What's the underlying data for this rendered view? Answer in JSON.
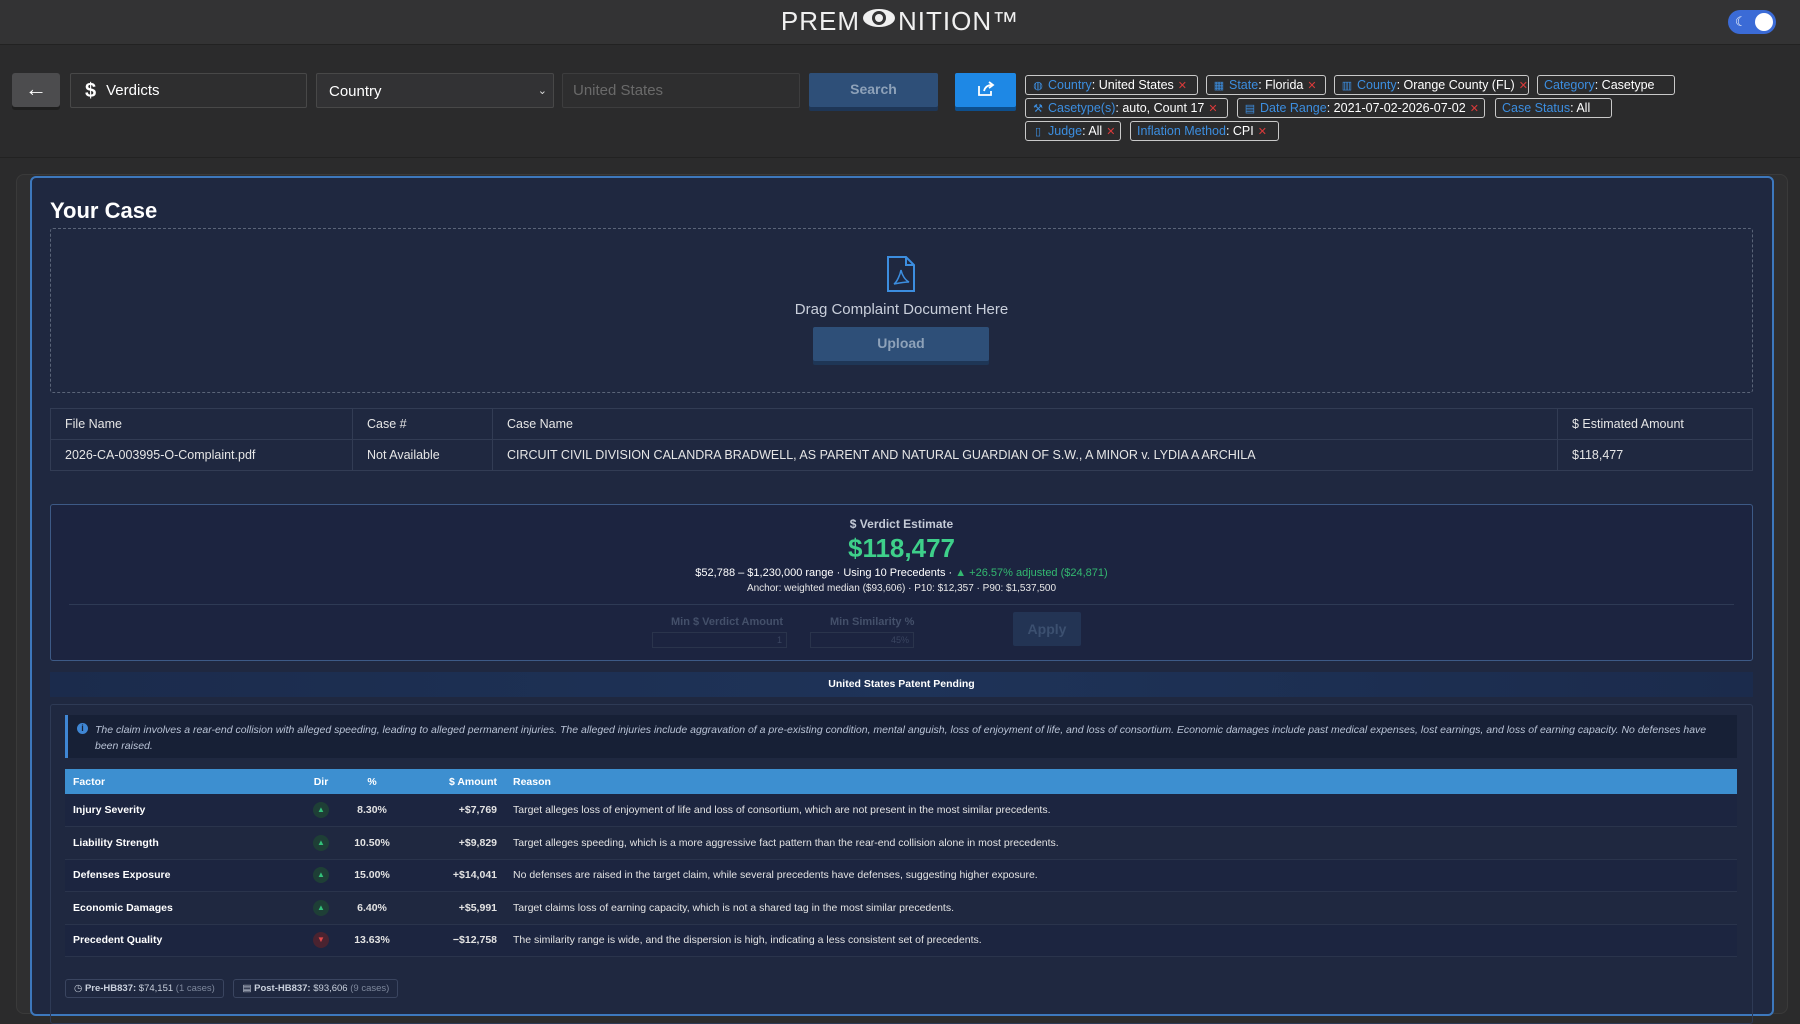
{
  "app": {
    "brand_left": "PREM",
    "brand_right": "NITION™"
  },
  "toolbar": {
    "verdicts_label": "Verdicts",
    "country_select": "Country",
    "country_value": "United States",
    "search_label": "Search"
  },
  "chips": [
    {
      "key": "Country",
      "value": ": United States",
      "icon": "globe-icon",
      "x": "✕"
    },
    {
      "key": "State",
      "value": ": Florida",
      "icon": "map-icon",
      "x": "✕"
    },
    {
      "key": "County",
      "value": ": Orange County (FL)",
      "icon": "building-icon",
      "x": "✕"
    },
    {
      "key": "Category",
      "value": ": Casetype",
      "icon": "",
      "x": ""
    },
    {
      "key": "Casetype(s)",
      "value": ": auto, Count 17",
      "icon": "gavel-icon",
      "x": "✕"
    },
    {
      "key": "Date Range",
      "value": ": 2021-07-02-2026-07-02",
      "icon": "calendar-icon",
      "x": "✕"
    },
    {
      "key": "Case Status",
      "value": ": All",
      "icon": "",
      "x": ""
    },
    {
      "key": "Judge",
      "value": ": All",
      "icon": "judge-icon",
      "x": "✕"
    },
    {
      "key": "Inflation Method",
      "value": ": CPI",
      "icon": "",
      "x": "✕"
    }
  ],
  "case": {
    "title": "Your Case",
    "drop_text": "Drag Complaint Document Here",
    "upload_label": "Upload",
    "table_headers": [
      "File Name",
      "Case #",
      "Case Name",
      "$ Estimated Amount"
    ],
    "table_row": [
      "2026-CA-003995-O-Complaint.pdf",
      "Not Available",
      "CIRCUIT CIVIL DIVISION CALANDRA BRADWELL, AS PARENT AND NATURAL GUARDIAN OF S.W., A MINOR v. LYDIA A ARCHILA",
      "$118,477"
    ]
  },
  "estimate": {
    "label": "$ Verdict Estimate",
    "value": "$118,477",
    "range": "$52,788 – $1,230,000 range",
    "precedents": "Using 10 Precedents",
    "adjusted": "▲ +26.57% adjusted ($24,871)",
    "anchor": "Anchor: weighted median ($93,606)",
    "p10": "P10: $12,357",
    "p90": "P90: $1,537,500",
    "min_amount_label": "Min $ Verdict Amount",
    "min_amount_value": "1",
    "min_similarity_label": "Min Similarity %",
    "min_similarity_value": "45%",
    "apply_label": "Apply"
  },
  "patent": "United States Patent Pending",
  "analysis": {
    "summary": "The claim involves a rear-end collision with alleged speeding, leading to alleged permanent injuries. The alleged injuries include aggravation of a pre-existing condition, mental anguish, loss of enjoyment of life, and loss of consortium. Economic damages include past medical expenses, lost earnings, and loss of earning capacity. No defenses have been raised.",
    "headers": [
      "Factor",
      "Dir",
      "%",
      "$ Amount",
      "Reason"
    ],
    "rows": [
      {
        "factor": "Injury Severity",
        "dir": "up",
        "pct": "8.30%",
        "amt": "+$7,769",
        "reason": "Target alleges loss of enjoyment of life and loss of consortium, which are not present in the most similar precedents."
      },
      {
        "factor": "Liability Strength",
        "dir": "up",
        "pct": "10.50%",
        "amt": "+$9,829",
        "reason": "Target alleges speeding, which is a more aggressive fact pattern than the rear-end collision alone in most precedents."
      },
      {
        "factor": "Defenses Exposure",
        "dir": "up",
        "pct": "15.00%",
        "amt": "+$14,041",
        "reason": "No defenses are raised in the target claim, while several precedents have defenses, suggesting higher exposure."
      },
      {
        "factor": "Economic Damages",
        "dir": "up",
        "pct": "6.40%",
        "amt": "+$5,991",
        "reason": "Target claims loss of earning capacity, which is not a shared tag in the most similar precedents."
      },
      {
        "factor": "Precedent Quality",
        "dir": "down",
        "pct": "13.63%",
        "amt": "−$12,758",
        "reason": "The similarity range is wide, and the dispersion is high, indicating a less consistent set of precedents."
      }
    ],
    "badges": [
      {
        "label": "Pre-HB837:",
        "value": "$74,151",
        "note": "(1 cases)"
      },
      {
        "label": "Post-HB837:",
        "value": "$93,606",
        "note": "(9 cases)"
      }
    ]
  }
}
